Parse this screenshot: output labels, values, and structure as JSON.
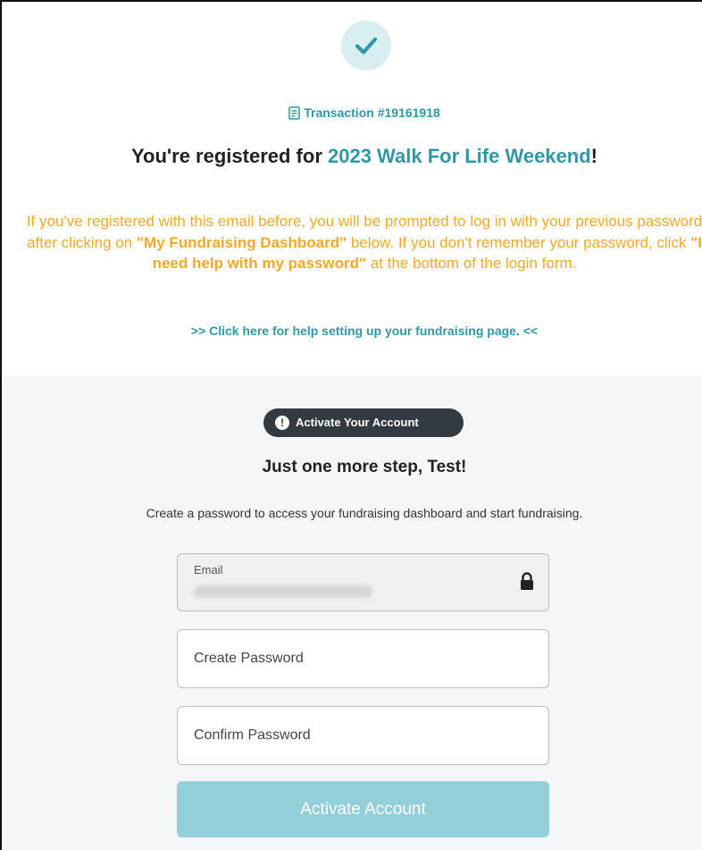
{
  "transaction": {
    "label": "Transaction #19161918",
    "icon": "receipt-icon"
  },
  "headline": {
    "prefix": "You're registered for ",
    "event_name": "2023 Walk For Life Weekend",
    "suffix": "!"
  },
  "notice": {
    "part1": "If you've registered with this email before, you will be prompted to log in with your previous password after clicking on ",
    "dashboard_label": "\"My Fundraising Dashboard\"",
    "part2": " below. If you don't remember your password, click ",
    "help_label": "\"I need help with my password\"",
    "part3": " at the bottom of the login form."
  },
  "help_link": ">> Click here for help setting up your fundraising page. <<",
  "activate_badge": {
    "label": "Activate Your Account",
    "icon": "exclamation-circle-icon"
  },
  "step": {
    "title": "Just one more step, Test!",
    "description": "Create a password to access your fundraising dashboard and start fundraising."
  },
  "form": {
    "email_label": "Email",
    "email_icon": "lock-icon",
    "create_password_placeholder": "Create Password",
    "confirm_password_placeholder": "Confirm Password",
    "submit_label": "Activate Account"
  },
  "colors": {
    "accent_teal": "#2f98a6",
    "notice_orange": "#efaa2a",
    "button_disabled": "#92cfd8",
    "badge_dark": "#333b40"
  }
}
